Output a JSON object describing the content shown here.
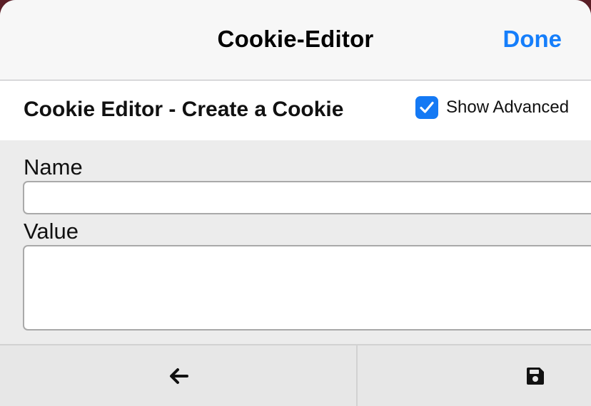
{
  "navbar": {
    "title": "Cookie-Editor",
    "done_label": "Done"
  },
  "header": {
    "title": "Cookie Editor - Create a Cookie",
    "show_advanced_label": "Show Advanced",
    "show_advanced_checked": true
  },
  "form": {
    "name_label": "Name",
    "name_value": "",
    "value_label": "Value",
    "value_value": ""
  },
  "toolbar": {
    "back_icon": "arrow-left-icon",
    "save_icon": "floppy-disk-icon"
  },
  "colors": {
    "accent": "#157efb",
    "checkbox": "#1479f4",
    "navbar_bg": "#f7f7f7",
    "form_bg": "#ececec",
    "backdrop": "#5a1e26"
  }
}
